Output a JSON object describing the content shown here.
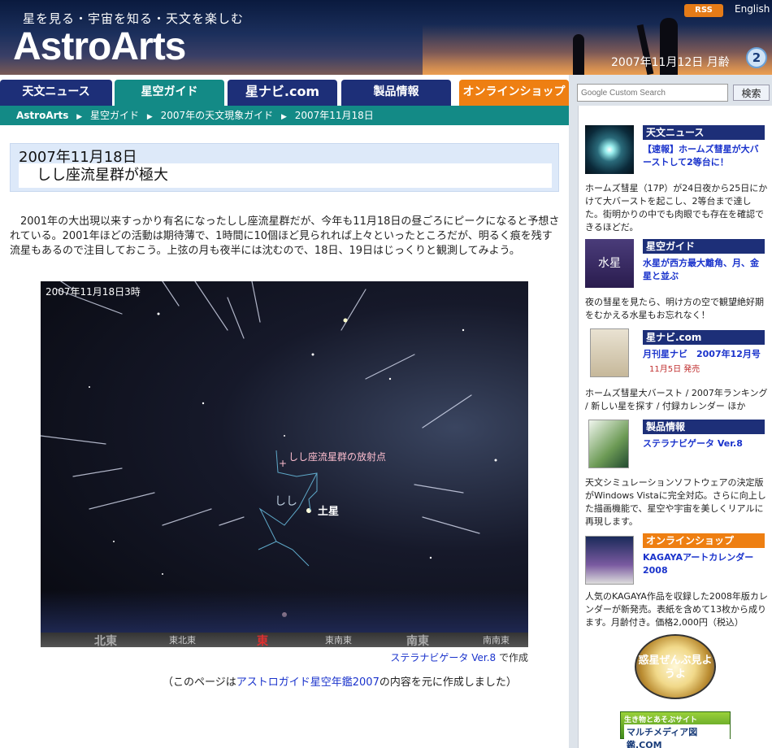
{
  "header": {
    "tagline": "星を見る・宇宙を知る・天文を楽しむ",
    "logo": "AstroArts",
    "rss_label": "RSS",
    "english_link": "English",
    "date": "2007年11月12日 月齢",
    "moon_age": "2"
  },
  "nav": {
    "tabs": [
      "天文ニュース",
      "星空ガイド",
      "星ナビ.com",
      "製品情報",
      "オンラインショップ"
    ]
  },
  "search": {
    "placeholder": "Google Custom Search",
    "button_label": "検索"
  },
  "breadcrumb": {
    "home": "AstroArts",
    "items": [
      "星空ガイド",
      "2007年の天文現象ガイド",
      "2007年11月18日"
    ]
  },
  "article": {
    "date_title": "2007年11月18日",
    "title": "しし座流星群が極大",
    "lead": "2001年の大出現以来すっかり有名になったしし座流星群だが、今年も11月18日の昼ごろにピークになると予想されている。2001年ほどの活動は期待薄で、1時間に10個ほど見られれば上々といったところだが、明るく痕を残す流星もあるので注目しておこう。上弦の月も夜半には沈むので、18日、19日はじっくりと観測してみよう。",
    "image": {
      "time_label": "2007年11月18日3時",
      "radiant_label": "しし座流星群の放射点",
      "radiant_marker": "+",
      "constellation_label": "しし",
      "saturn_label": "土星",
      "directions": [
        "北東",
        "東北東",
        "東",
        "東南東",
        "南東",
        "南南東"
      ]
    },
    "credit_link": "ステラナビゲータ Ver.8",
    "credit_suffix": " で作成",
    "source_prefix": "（このページは",
    "source_link": "アストロガイド星空年鑑2007",
    "source_suffix": "の内容を元に作成しました）"
  },
  "sidebar": {
    "news": {
      "head": "天文ニュース",
      "link": "【速報】ホームズ彗星が大バーストして2等台に！",
      "text": "ホームズ彗星（17P）が24日夜から25日にかけて大バーストを起こし、2等台まで達した。街明かりの中でも肉眼でも存在を確認できるほどだ。"
    },
    "guide": {
      "head": "星空ガイド",
      "thumb_label": "水星",
      "link": "水星が西方最大離角、月、金星と並ぶ",
      "text": "夜の彗星を見たら、明け方の空で観望絶好期をむかえる水星もお忘れなく！"
    },
    "navi": {
      "head": "星ナビ.com",
      "link": "月刊星ナビ　2007年12月号",
      "sub": "11月5日 発売",
      "text": "ホームズ彗星大バースト / 2007年ランキング / 新しい星を探す / 付録カレンダー ほか"
    },
    "products": {
      "head": "製品情報",
      "link": "ステラナビゲータ Ver.8",
      "text": "天文シミュレーションソフトウェアの決定版がWindows Vistaに完全対応。さらに向上した描画機能で、星空や宇宙を美しくリアルに再現します。"
    },
    "shop": {
      "head": "オンラインショップ",
      "link": "KAGAYAアートカレンダー2008",
      "text": "人気のKAGAYA作品を収録した2008年版カレンダーが新発売。表紙を含めて13枚から成ります。月齢付き。価格2,000円（税込）"
    },
    "banner_planets": "惑星ぜんぶ見ようよ",
    "banner_multi_top": "生き物とあそぶサイト",
    "banner_multi_mid": "マルチメディア図鑑.COM"
  },
  "colors": {
    "nav_blue": "#1d2f78",
    "teal": "#138a86",
    "orange": "#ee7f12",
    "link": "#1a33cc"
  }
}
